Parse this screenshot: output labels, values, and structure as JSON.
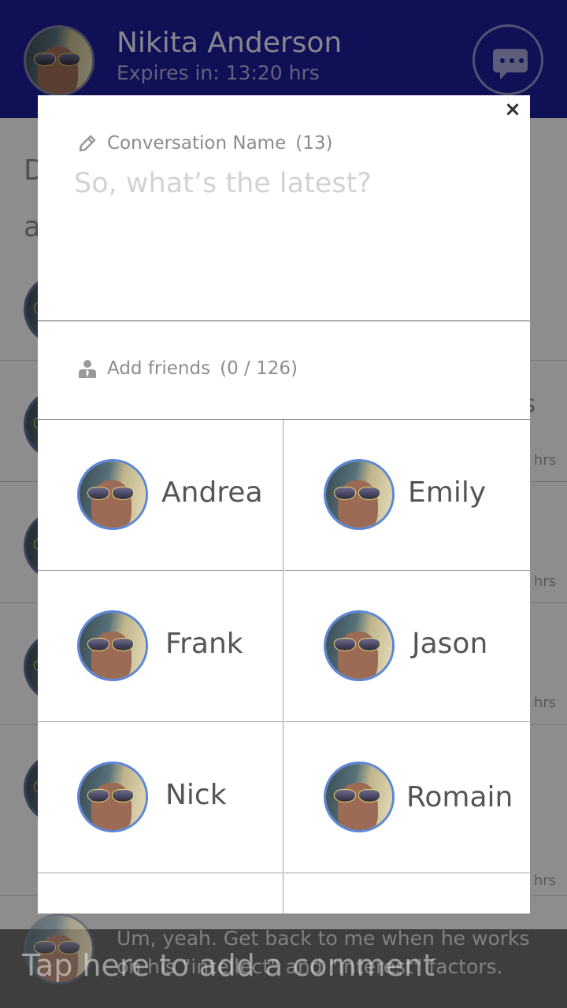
{
  "header": {
    "name": "Nikita Anderson",
    "expiry": "Expires in: 13:20 hrs"
  },
  "background": {
    "letter_d": "D",
    "letter_a": "a",
    "trailing_s": "s",
    "hrs_labels": [
      "hrs",
      "hrs",
      "hrs",
      "hrs"
    ]
  },
  "modal": {
    "close_label": "×",
    "conversation_label": "Conversation Name",
    "conversation_count": "(13)",
    "conversation_placeholder": "So, what’s the latest?",
    "friends_label": "Add friends",
    "friends_count": "(0 / 126)",
    "friends": [
      {
        "name": "Andrea"
      },
      {
        "name": "Emily"
      },
      {
        "name": "Frank"
      },
      {
        "name": "Jason"
      },
      {
        "name": "Nick"
      },
      {
        "name": "Romain"
      }
    ]
  },
  "comment": {
    "message": "Um, yeah. Get back to me when he works on his \"intellect\" and \"interest\" factors.",
    "placeholder": "Tap here to add a comment"
  },
  "colors": {
    "header_bg": "#1b1d93",
    "avatar_ring": "#5b86d8"
  },
  "icons": {
    "pencil": "pencil-icon",
    "user": "user-icon",
    "chat": "chat-icon",
    "close": "close-icon"
  }
}
